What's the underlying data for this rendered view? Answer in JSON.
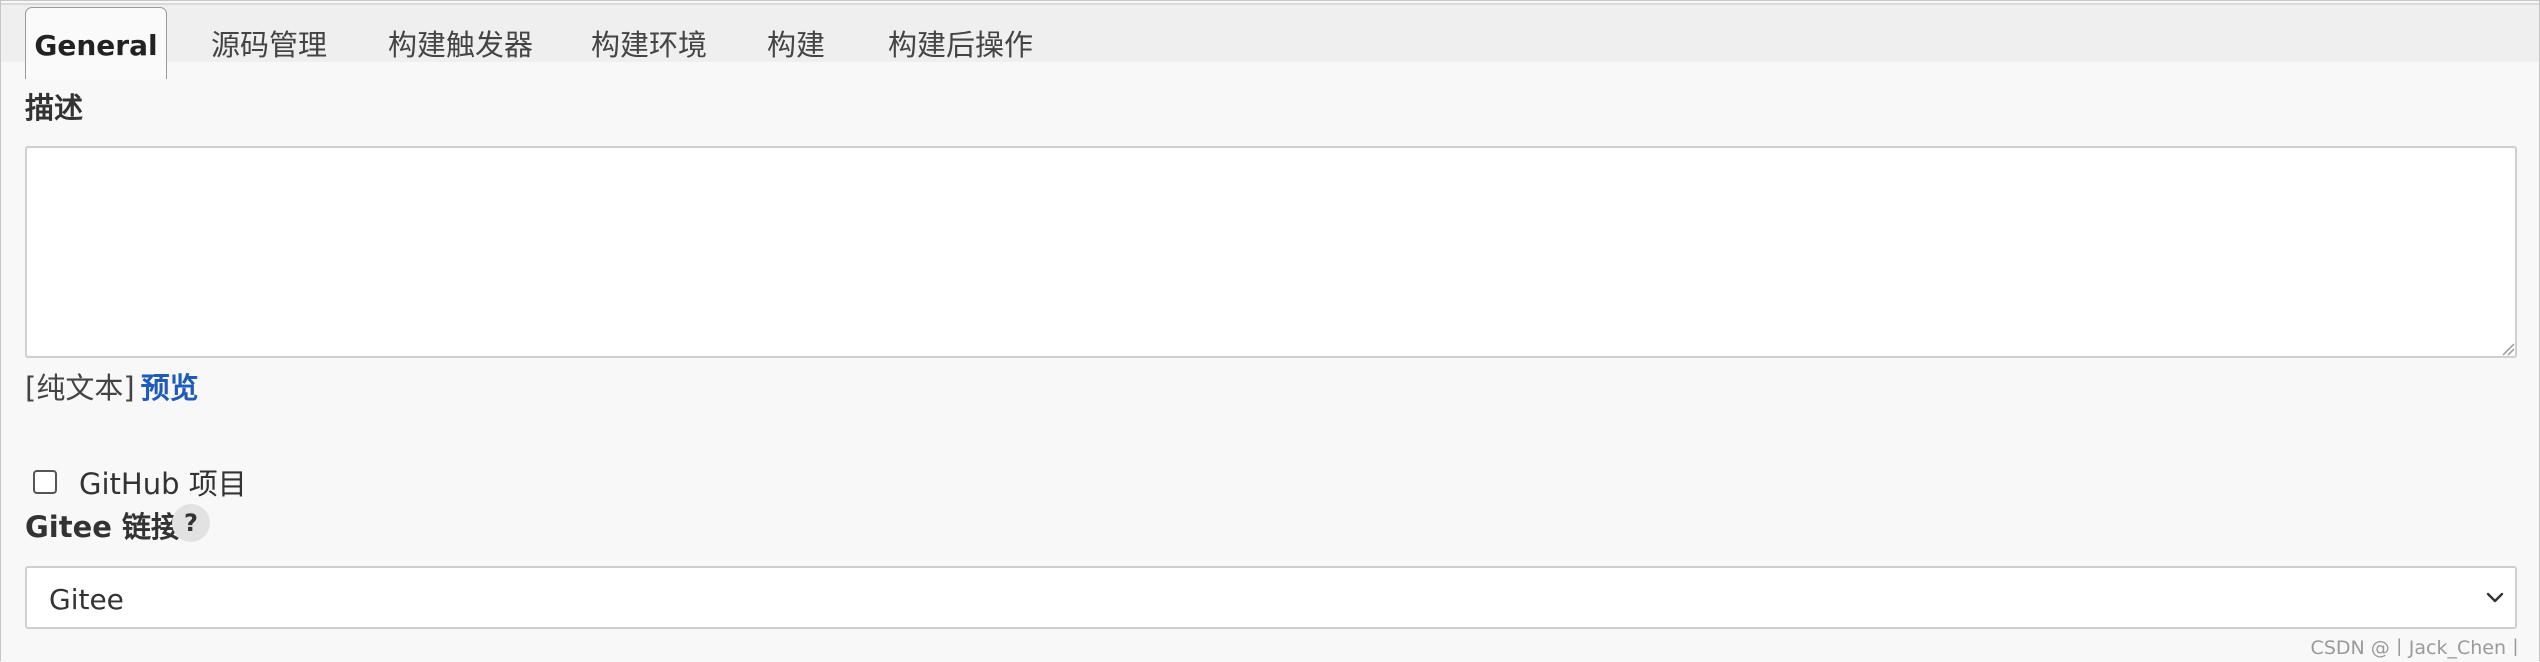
{
  "tabs": [
    {
      "label": "General"
    },
    {
      "label": "源码管理"
    },
    {
      "label": "构建触发器"
    },
    {
      "label": "构建环境"
    },
    {
      "label": "构建"
    },
    {
      "label": "构建后操作"
    }
  ],
  "description": {
    "label": "描述",
    "value": "",
    "format_plain": "[纯文本]",
    "format_preview": "预览"
  },
  "github_project": {
    "label": "GitHub 项目",
    "checked": false
  },
  "gitee_link": {
    "label": "Gitee 链接",
    "help": "?",
    "selected": "Gitee"
  },
  "watermark": "CSDN @丨Jack_Chen丨"
}
